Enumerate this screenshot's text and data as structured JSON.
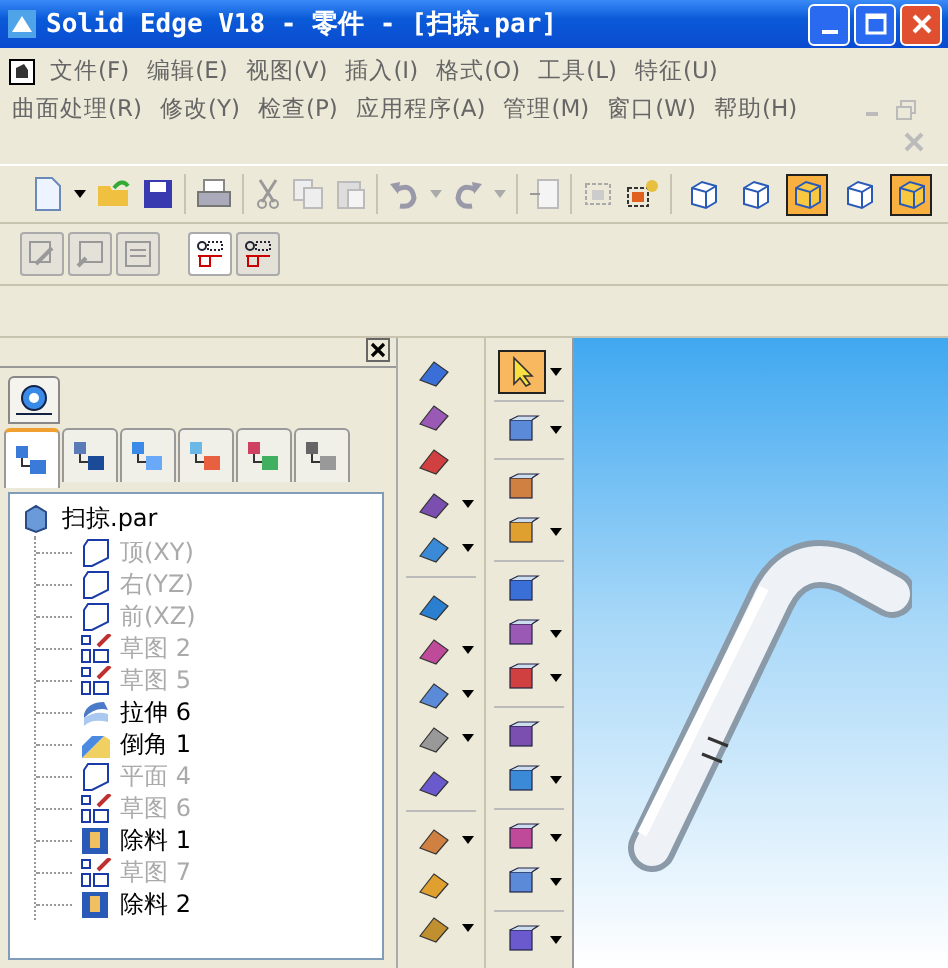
{
  "window": {
    "title": "Solid Edge V18 - 零件 - [扫掠.par]"
  },
  "menu_rows": [
    [
      "文件(F)",
      "编辑(E)",
      "视图(V)",
      "插入(I)",
      "格式(O)",
      "工具(L)",
      "特征(U)"
    ],
    [
      "曲面处理(R)",
      "修改(Y)",
      "检查(P)",
      "应用程序(A)",
      "管理(M)",
      "窗口(W)",
      "帮助(H)"
    ]
  ],
  "view_modes": [
    {
      "selected": false
    },
    {
      "selected": false
    },
    {
      "selected": true
    },
    {
      "selected": false
    },
    {
      "selected": true
    }
  ],
  "panel_tabs": [
    {
      "selected": true
    },
    {
      "selected": false
    },
    {
      "selected": false
    },
    {
      "selected": false
    },
    {
      "selected": false
    },
    {
      "selected": false
    }
  ],
  "tree": {
    "label": "扫掠.par",
    "kind": "part",
    "children": [
      {
        "label": "顶(XY)",
        "kind": "plane",
        "disabled": true
      },
      {
        "label": "右(YZ)",
        "kind": "plane",
        "disabled": true
      },
      {
        "label": "前(XZ)",
        "kind": "plane",
        "disabled": true
      },
      {
        "label": "草图 2",
        "kind": "sketch",
        "disabled": true
      },
      {
        "label": "草图 5",
        "kind": "sketch",
        "disabled": true
      },
      {
        "label": "拉伸 6",
        "kind": "protrusion",
        "disabled": false
      },
      {
        "label": "倒角 1",
        "kind": "chamfer",
        "disabled": false
      },
      {
        "label": "平面 4",
        "kind": "plane",
        "disabled": true
      },
      {
        "label": "草图 6",
        "kind": "sketch",
        "disabled": true
      },
      {
        "label": "除料 1",
        "kind": "cutout",
        "disabled": false
      },
      {
        "label": "草图 7",
        "kind": "sketch",
        "disabled": true
      },
      {
        "label": "除料 2",
        "kind": "cutout",
        "disabled": false
      }
    ]
  },
  "tool_column_1": [
    [
      {
        "dropdown": false
      },
      {
        "dropdown": false
      },
      {
        "dropdown": false
      },
      {
        "dropdown": true
      },
      {
        "dropdown": true
      }
    ],
    [
      {
        "dropdown": false
      },
      {
        "dropdown": true
      },
      {
        "dropdown": true
      },
      {
        "dropdown": true
      },
      {
        "dropdown": false
      }
    ],
    [
      {
        "dropdown": true
      },
      {
        "dropdown": false
      },
      {
        "dropdown": true
      }
    ]
  ],
  "tool_column_2": [
    [
      {
        "dropdown": true,
        "selected": true
      }
    ],
    [
      {
        "dropdown": true,
        "selected": false
      }
    ],
    [
      {
        "dropdown": false,
        "selected": false
      },
      {
        "dropdown": true,
        "selected": false
      }
    ],
    [
      {
        "dropdown": false,
        "selected": false
      },
      {
        "dropdown": true,
        "selected": false
      },
      {
        "dropdown": true,
        "selected": false
      }
    ],
    [
      {
        "dropdown": false,
        "selected": false
      },
      {
        "dropdown": true,
        "selected": false
      }
    ],
    [
      {
        "dropdown": true,
        "selected": false
      },
      {
        "dropdown": true,
        "selected": false
      }
    ],
    [
      {
        "dropdown": true,
        "selected": false
      }
    ]
  ]
}
